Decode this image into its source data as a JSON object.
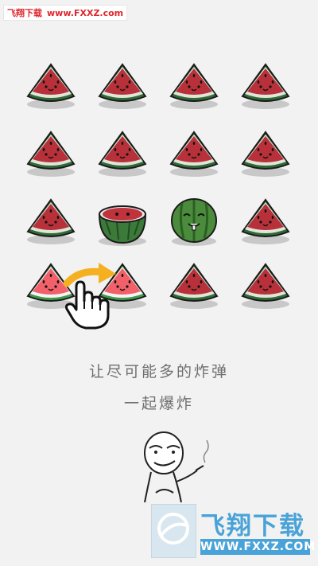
{
  "watermark_top": {
    "site_name": "飞翔下载",
    "url": "www.FXXZ.com"
  },
  "hint": {
    "line1": "让尽可能多的炸弹",
    "line2": "一起爆炸"
  },
  "board": {
    "rows": [
      [
        "watermelon-slice",
        "watermelon-slice",
        "watermelon-slice",
        "watermelon-slice"
      ],
      [
        "watermelon-slice",
        "watermelon-slice",
        "watermelon-slice",
        "watermelon-slice"
      ],
      [
        "watermelon-slice",
        "watermelon-half",
        "watermelon-whole",
        "watermelon-slice"
      ],
      [
        "watermelon-slice-highlighted",
        "watermelon-slice-highlighted",
        "watermelon-slice",
        "watermelon-slice"
      ]
    ]
  },
  "colors": {
    "background": "#f2f2f2",
    "arrow": "#f5b021",
    "hint_text": "#6f6f6f",
    "watermark_blue": "#4aa3d8"
  },
  "watermark_bottom": {
    "brand": "飞翔下载",
    "url": "WWW.FXXZ.COM"
  }
}
